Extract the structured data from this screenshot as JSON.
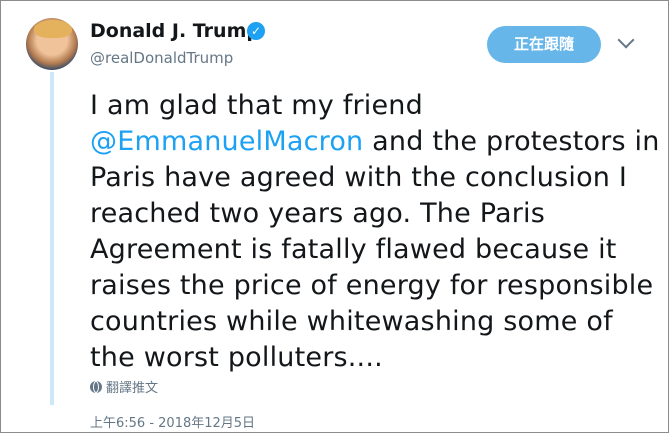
{
  "tweet": {
    "author_name": "Donald J. Trump",
    "handle": "@realDonaldTrump",
    "follow_label": "正在跟隨",
    "text_before_mention": "I am glad that my friend ",
    "mention": "@EmmanuelMacron",
    "text_after_mention": " and the protestors in Paris have agreed with the conclusion I reached two years ago. The Paris Agreement is fatally flawed because it raises the price of energy for responsible countries while whitewashing some of the worst polluters....",
    "translate_label": "翻譯推文",
    "timestamp": "上午6:56 - 2018年12月5日",
    "verified_icon": "check",
    "accent_color": "#1da1f2"
  }
}
